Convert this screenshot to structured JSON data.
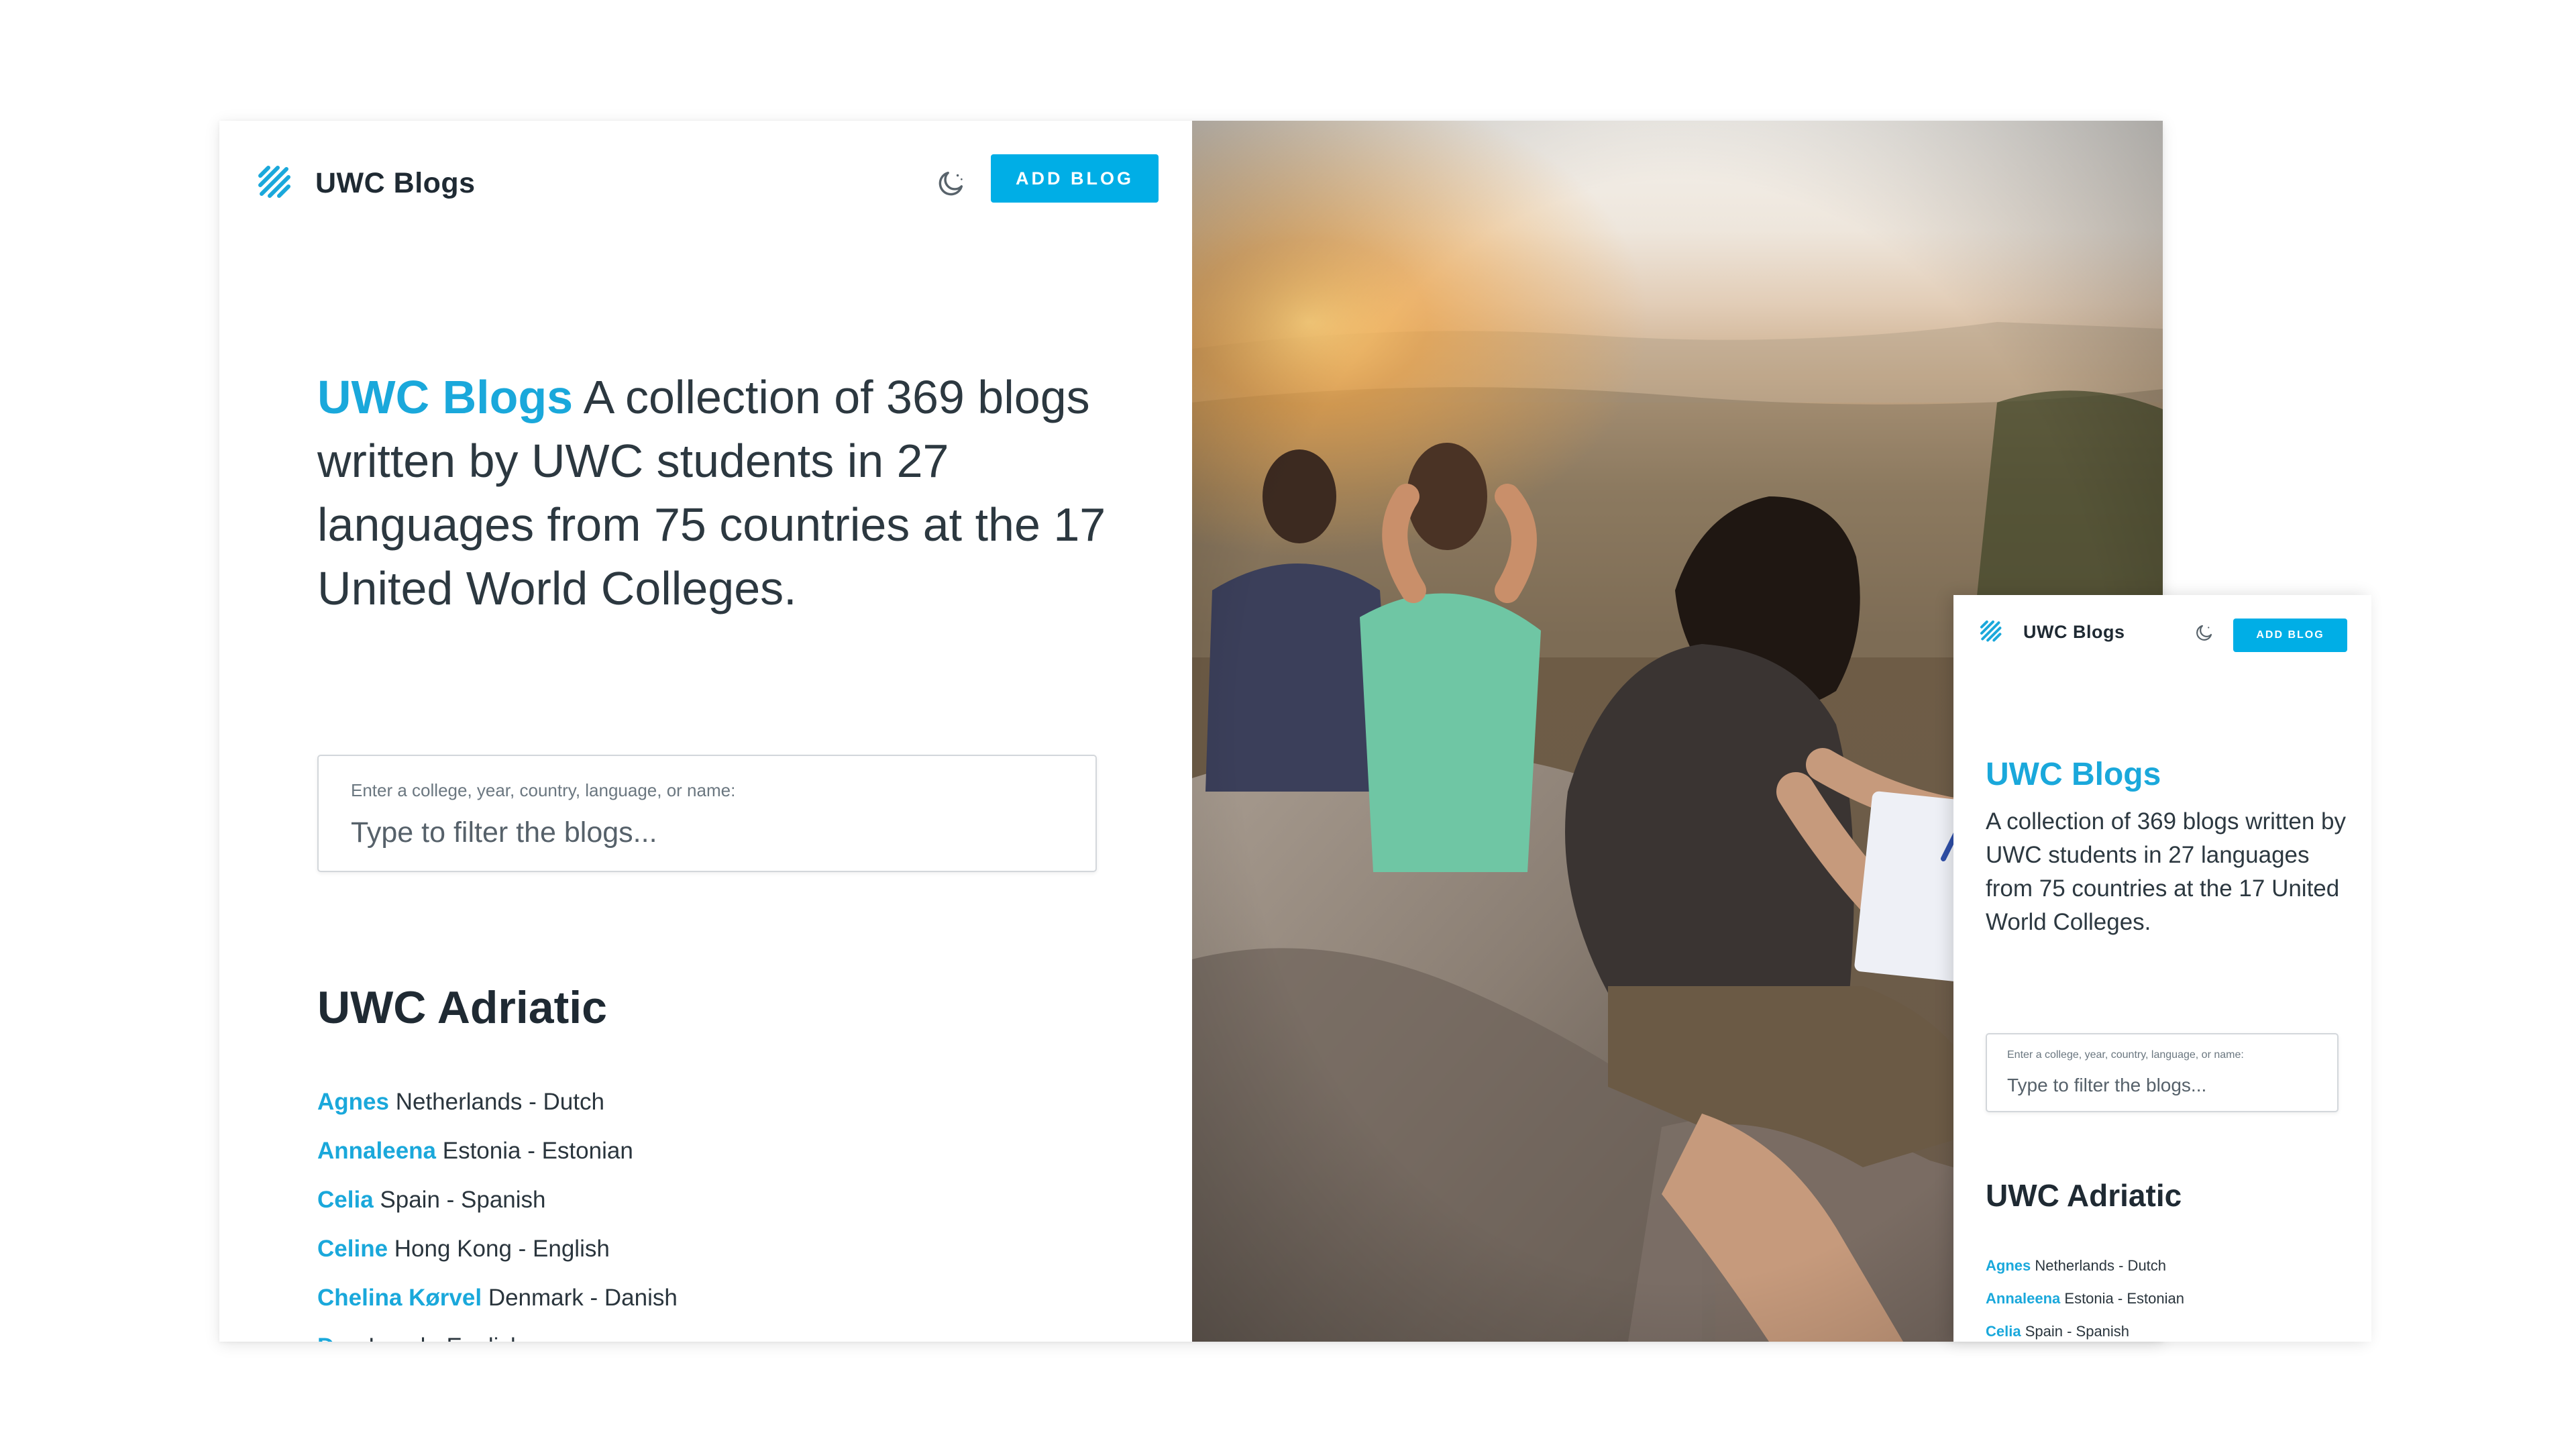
{
  "brand": {
    "name": "UWC Blogs",
    "accent": "#1aa8db",
    "button_color": "#00aee6"
  },
  "header": {
    "theme_icon": "moon-icon",
    "add_blog_label": "ADD BLOG"
  },
  "intro": {
    "highlight": "UWC Blogs",
    "text": "A collection of 369 blogs written by UWC students in 27 languages from 75 countries at the 17 United World Colleges."
  },
  "search": {
    "label": "Enter a college, year, country, language, or name:",
    "placeholder": "Type to filter the blogs..."
  },
  "section": {
    "title": "UWC Adriatic",
    "blogs": [
      {
        "name": "Agnes",
        "detail": "Netherlands - Dutch"
      },
      {
        "name": "Annaleena",
        "detail": "Estonia - Estonian"
      },
      {
        "name": "Celia",
        "detail": "Spain - Spanish"
      },
      {
        "name": "Celine",
        "detail": "Hong Kong - English"
      },
      {
        "name": "Chelina Kørvel",
        "detail": "Denmark - Danish"
      },
      {
        "name": "Dan",
        "detail": "Israel - English"
      }
    ]
  },
  "photo": {
    "description_icon": "hero-photo"
  }
}
